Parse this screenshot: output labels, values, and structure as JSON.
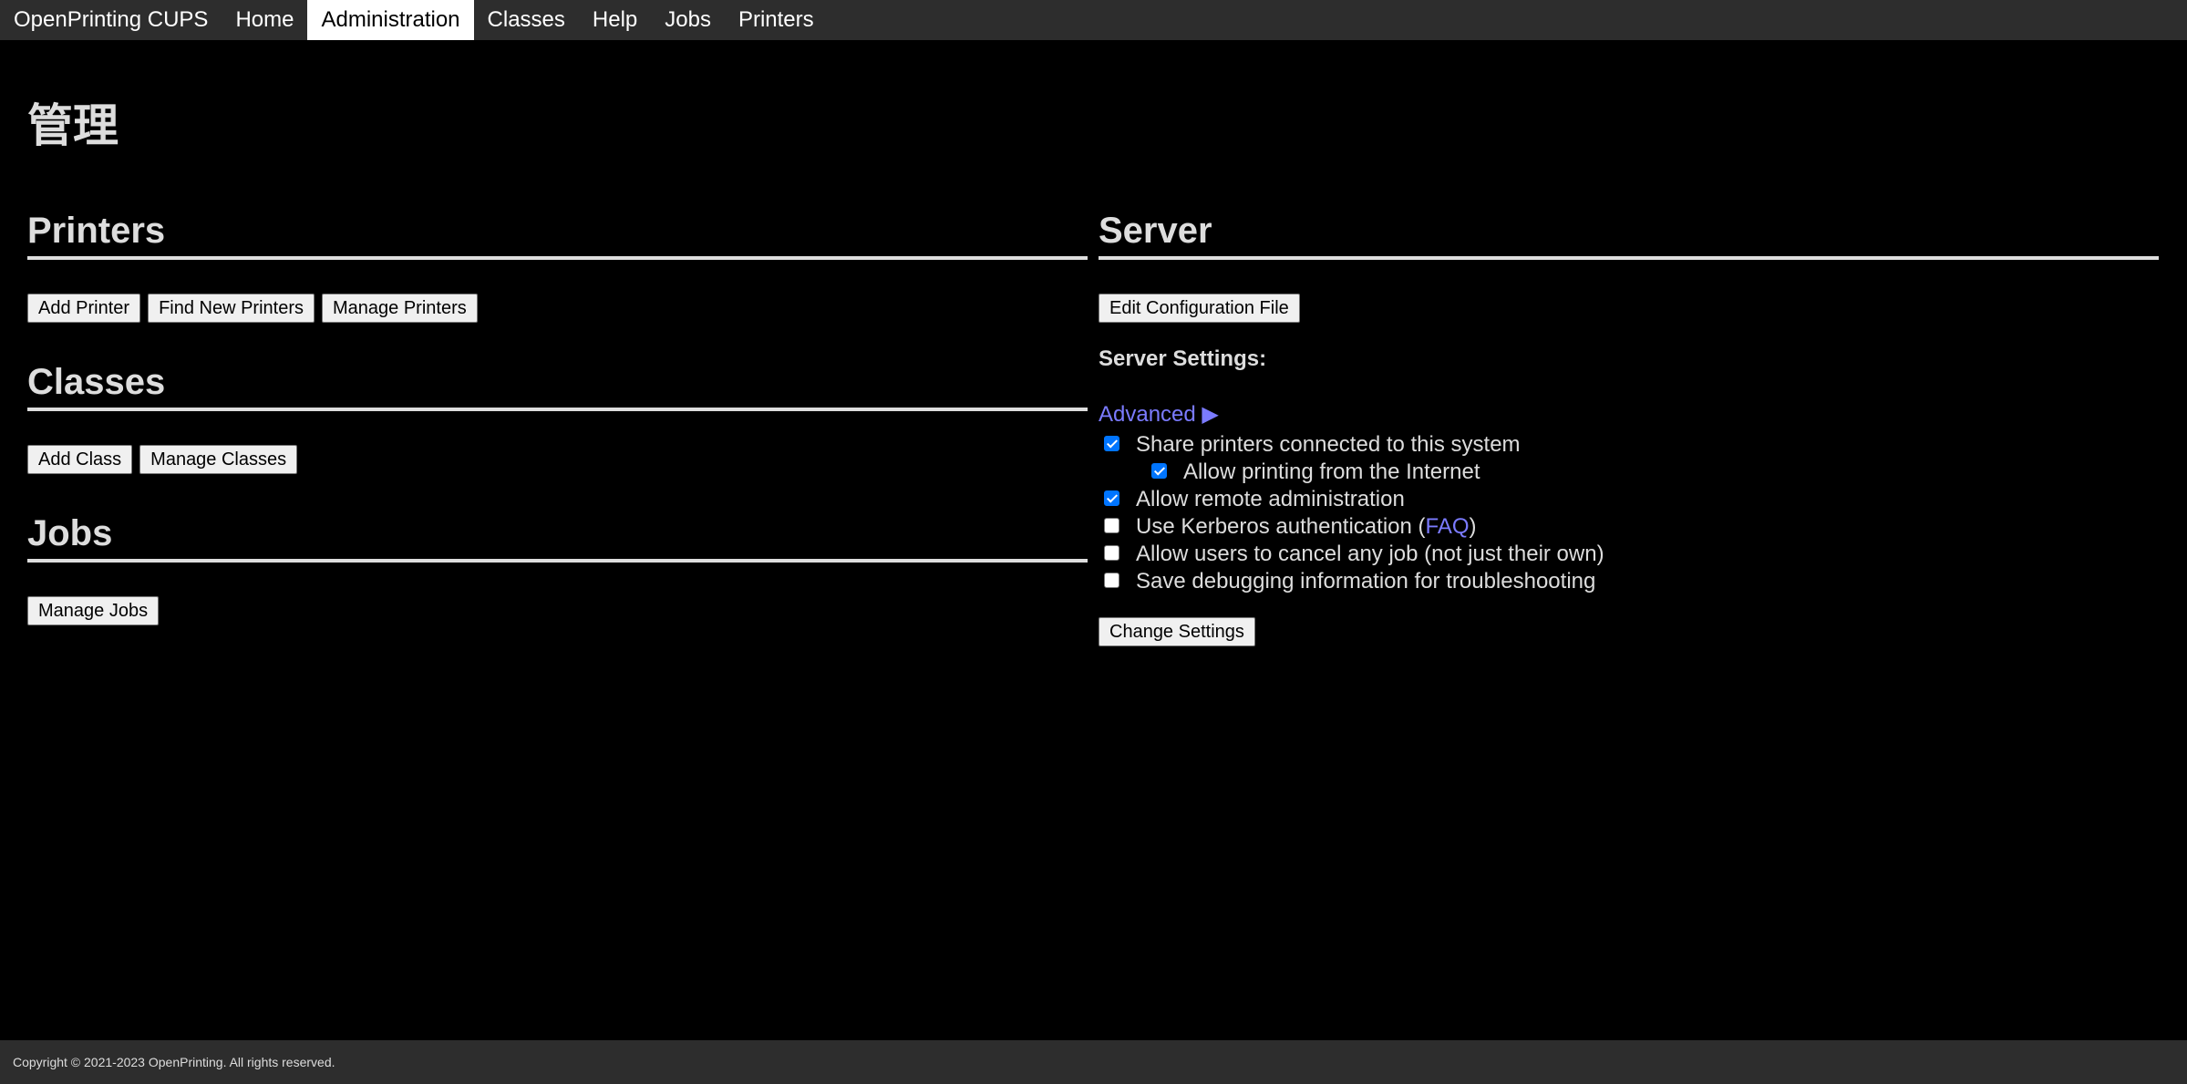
{
  "nav": {
    "items": [
      {
        "label": "OpenPrinting CUPS",
        "active": false
      },
      {
        "label": "Home",
        "active": false
      },
      {
        "label": "Administration",
        "active": true
      },
      {
        "label": "Classes",
        "active": false
      },
      {
        "label": "Help",
        "active": false
      },
      {
        "label": "Jobs",
        "active": false
      },
      {
        "label": "Printers",
        "active": false
      }
    ]
  },
  "page": {
    "title": "管理"
  },
  "printers": {
    "heading": "Printers",
    "add_printer": "Add Printer",
    "find_new_printers": "Find New Printers",
    "manage_printers": "Manage Printers"
  },
  "classes": {
    "heading": "Classes",
    "add_class": "Add Class",
    "manage_classes": "Manage Classes"
  },
  "jobs": {
    "heading": "Jobs",
    "manage_jobs": "Manage Jobs"
  },
  "server": {
    "heading": "Server",
    "edit_config": "Edit Configuration File",
    "settings_label": "Server Settings:",
    "advanced": "Advanced ▶",
    "options": {
      "share_printers": {
        "label": "Share printers connected to this system",
        "checked": true
      },
      "allow_internet": {
        "label": "Allow printing from the Internet",
        "checked": true
      },
      "remote_admin": {
        "label": "Allow remote administration",
        "checked": true
      },
      "kerberos": {
        "label_before": "Use Kerberos authentication (",
        "link": "FAQ",
        "label_after": ")",
        "checked": false
      },
      "cancel_any": {
        "label": "Allow users to cancel any job (not just their own)",
        "checked": false
      },
      "debug_logging": {
        "label": "Save debugging information for troubleshooting",
        "checked": false
      }
    },
    "change_settings": "Change Settings"
  },
  "footer": {
    "copyright": "Copyright © 2021-2023 OpenPrinting. All rights reserved."
  }
}
